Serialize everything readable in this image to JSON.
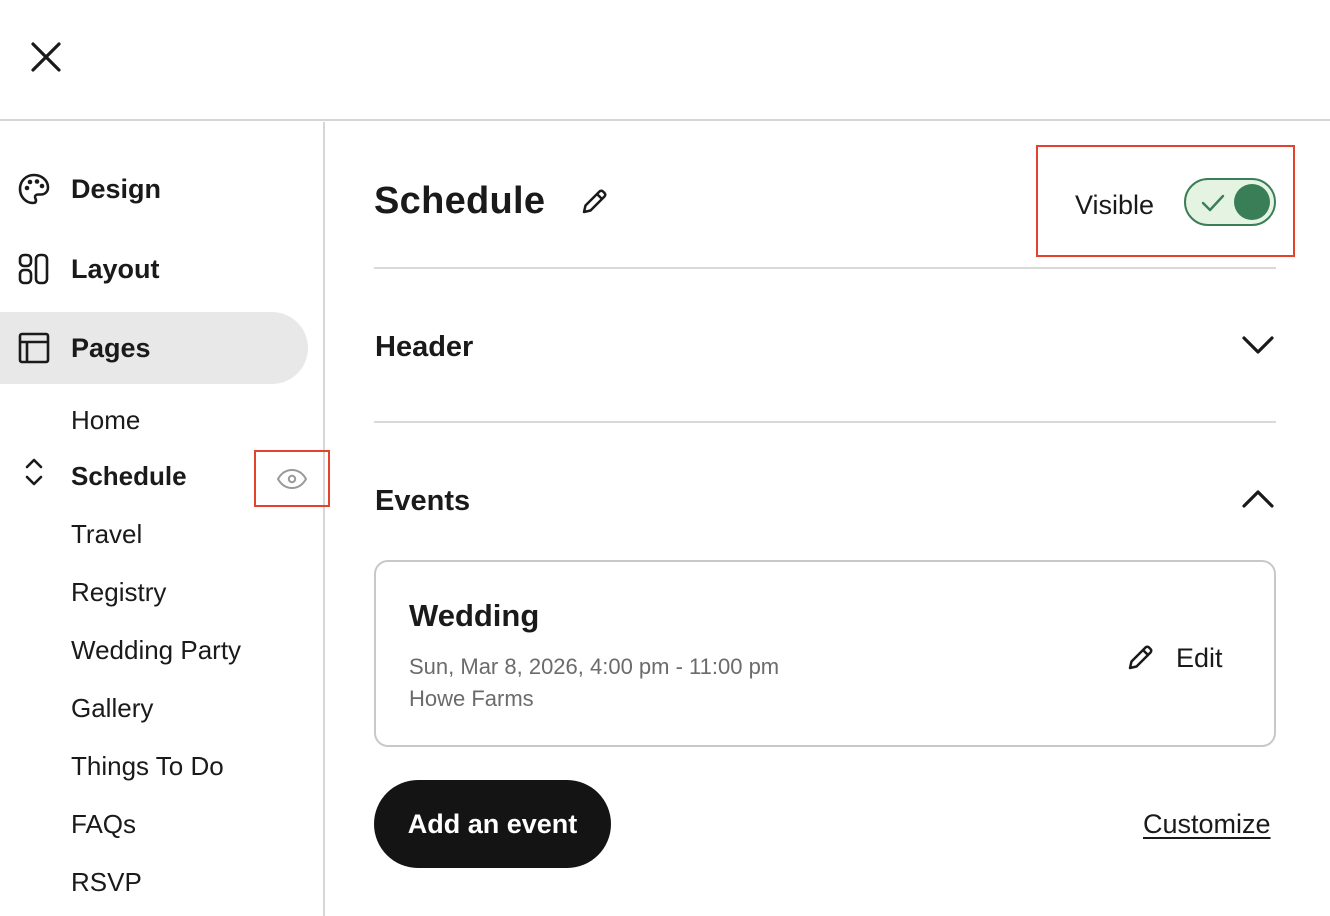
{
  "icons": {
    "close": "close-icon",
    "design": "palette-icon",
    "layout": "layout-grid-icon",
    "pages": "browser-window-icon",
    "reorder": "chevron-up-down-icon",
    "visibility": "eye-icon",
    "edit": "pencil-icon",
    "chevron_down": "chevron-down-icon",
    "chevron_up": "chevron-up-icon",
    "check": "check-icon"
  },
  "colors": {
    "highlight": "#e2432d",
    "toggle_on": "#3a7e57",
    "toggle_bg": "#e4f3e2",
    "primary_button": "#141414",
    "active_nav_bg": "#e8e8e8"
  },
  "sidebar": {
    "nav": [
      {
        "label": "Design",
        "active": false
      },
      {
        "label": "Layout",
        "active": false
      },
      {
        "label": "Pages",
        "active": true
      }
    ],
    "pages": [
      {
        "label": "Home"
      },
      {
        "label": "Schedule",
        "current": true
      },
      {
        "label": "Travel"
      },
      {
        "label": "Registry"
      },
      {
        "label": "Wedding Party"
      },
      {
        "label": "Gallery"
      },
      {
        "label": "Things To Do"
      },
      {
        "label": "FAQs"
      },
      {
        "label": "RSVP"
      }
    ]
  },
  "main": {
    "title": "Schedule",
    "visibility": {
      "label": "Visible",
      "enabled": true
    },
    "sections": [
      {
        "label": "Header",
        "expanded": false
      },
      {
        "label": "Events",
        "expanded": true
      }
    ],
    "events": [
      {
        "title": "Wedding",
        "time": "Sun, Mar 8, 2026, 4:00 pm - 11:00 pm",
        "location": "Howe Farms",
        "edit_label": "Edit"
      }
    ],
    "add_event_label": "Add an event",
    "customize_label": "Customize"
  }
}
